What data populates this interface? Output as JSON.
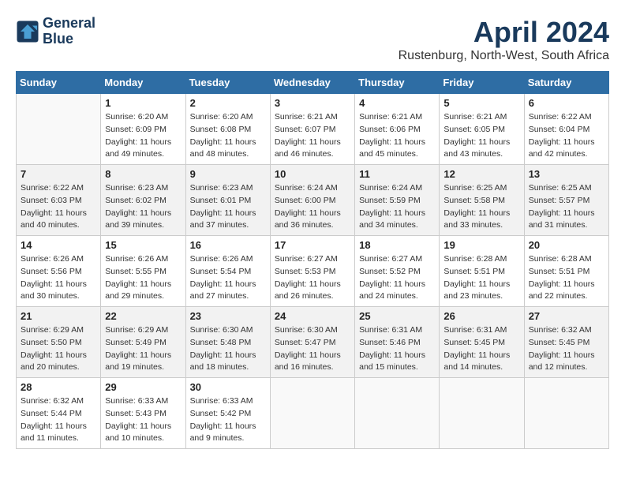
{
  "header": {
    "logo_line1": "General",
    "logo_line2": "Blue",
    "month_title": "April 2024",
    "location": "Rustenburg, North-West, South Africa"
  },
  "weekdays": [
    "Sunday",
    "Monday",
    "Tuesday",
    "Wednesday",
    "Thursday",
    "Friday",
    "Saturday"
  ],
  "weeks": [
    [
      {
        "day": "",
        "info": ""
      },
      {
        "day": "1",
        "info": "Sunrise: 6:20 AM\nSunset: 6:09 PM\nDaylight: 11 hours\nand 49 minutes."
      },
      {
        "day": "2",
        "info": "Sunrise: 6:20 AM\nSunset: 6:08 PM\nDaylight: 11 hours\nand 48 minutes."
      },
      {
        "day": "3",
        "info": "Sunrise: 6:21 AM\nSunset: 6:07 PM\nDaylight: 11 hours\nand 46 minutes."
      },
      {
        "day": "4",
        "info": "Sunrise: 6:21 AM\nSunset: 6:06 PM\nDaylight: 11 hours\nand 45 minutes."
      },
      {
        "day": "5",
        "info": "Sunrise: 6:21 AM\nSunset: 6:05 PM\nDaylight: 11 hours\nand 43 minutes."
      },
      {
        "day": "6",
        "info": "Sunrise: 6:22 AM\nSunset: 6:04 PM\nDaylight: 11 hours\nand 42 minutes."
      }
    ],
    [
      {
        "day": "7",
        "info": "Sunrise: 6:22 AM\nSunset: 6:03 PM\nDaylight: 11 hours\nand 40 minutes."
      },
      {
        "day": "8",
        "info": "Sunrise: 6:23 AM\nSunset: 6:02 PM\nDaylight: 11 hours\nand 39 minutes."
      },
      {
        "day": "9",
        "info": "Sunrise: 6:23 AM\nSunset: 6:01 PM\nDaylight: 11 hours\nand 37 minutes."
      },
      {
        "day": "10",
        "info": "Sunrise: 6:24 AM\nSunset: 6:00 PM\nDaylight: 11 hours\nand 36 minutes."
      },
      {
        "day": "11",
        "info": "Sunrise: 6:24 AM\nSunset: 5:59 PM\nDaylight: 11 hours\nand 34 minutes."
      },
      {
        "day": "12",
        "info": "Sunrise: 6:25 AM\nSunset: 5:58 PM\nDaylight: 11 hours\nand 33 minutes."
      },
      {
        "day": "13",
        "info": "Sunrise: 6:25 AM\nSunset: 5:57 PM\nDaylight: 11 hours\nand 31 minutes."
      }
    ],
    [
      {
        "day": "14",
        "info": "Sunrise: 6:26 AM\nSunset: 5:56 PM\nDaylight: 11 hours\nand 30 minutes."
      },
      {
        "day": "15",
        "info": "Sunrise: 6:26 AM\nSunset: 5:55 PM\nDaylight: 11 hours\nand 29 minutes."
      },
      {
        "day": "16",
        "info": "Sunrise: 6:26 AM\nSunset: 5:54 PM\nDaylight: 11 hours\nand 27 minutes."
      },
      {
        "day": "17",
        "info": "Sunrise: 6:27 AM\nSunset: 5:53 PM\nDaylight: 11 hours\nand 26 minutes."
      },
      {
        "day": "18",
        "info": "Sunrise: 6:27 AM\nSunset: 5:52 PM\nDaylight: 11 hours\nand 24 minutes."
      },
      {
        "day": "19",
        "info": "Sunrise: 6:28 AM\nSunset: 5:51 PM\nDaylight: 11 hours\nand 23 minutes."
      },
      {
        "day": "20",
        "info": "Sunrise: 6:28 AM\nSunset: 5:51 PM\nDaylight: 11 hours\nand 22 minutes."
      }
    ],
    [
      {
        "day": "21",
        "info": "Sunrise: 6:29 AM\nSunset: 5:50 PM\nDaylight: 11 hours\nand 20 minutes."
      },
      {
        "day": "22",
        "info": "Sunrise: 6:29 AM\nSunset: 5:49 PM\nDaylight: 11 hours\nand 19 minutes."
      },
      {
        "day": "23",
        "info": "Sunrise: 6:30 AM\nSunset: 5:48 PM\nDaylight: 11 hours\nand 18 minutes."
      },
      {
        "day": "24",
        "info": "Sunrise: 6:30 AM\nSunset: 5:47 PM\nDaylight: 11 hours\nand 16 minutes."
      },
      {
        "day": "25",
        "info": "Sunrise: 6:31 AM\nSunset: 5:46 PM\nDaylight: 11 hours\nand 15 minutes."
      },
      {
        "day": "26",
        "info": "Sunrise: 6:31 AM\nSunset: 5:45 PM\nDaylight: 11 hours\nand 14 minutes."
      },
      {
        "day": "27",
        "info": "Sunrise: 6:32 AM\nSunset: 5:45 PM\nDaylight: 11 hours\nand 12 minutes."
      }
    ],
    [
      {
        "day": "28",
        "info": "Sunrise: 6:32 AM\nSunset: 5:44 PM\nDaylight: 11 hours\nand 11 minutes."
      },
      {
        "day": "29",
        "info": "Sunrise: 6:33 AM\nSunset: 5:43 PM\nDaylight: 11 hours\nand 10 minutes."
      },
      {
        "day": "30",
        "info": "Sunrise: 6:33 AM\nSunset: 5:42 PM\nDaylight: 11 hours\nand 9 minutes."
      },
      {
        "day": "",
        "info": ""
      },
      {
        "day": "",
        "info": ""
      },
      {
        "day": "",
        "info": ""
      },
      {
        "day": "",
        "info": ""
      }
    ]
  ]
}
